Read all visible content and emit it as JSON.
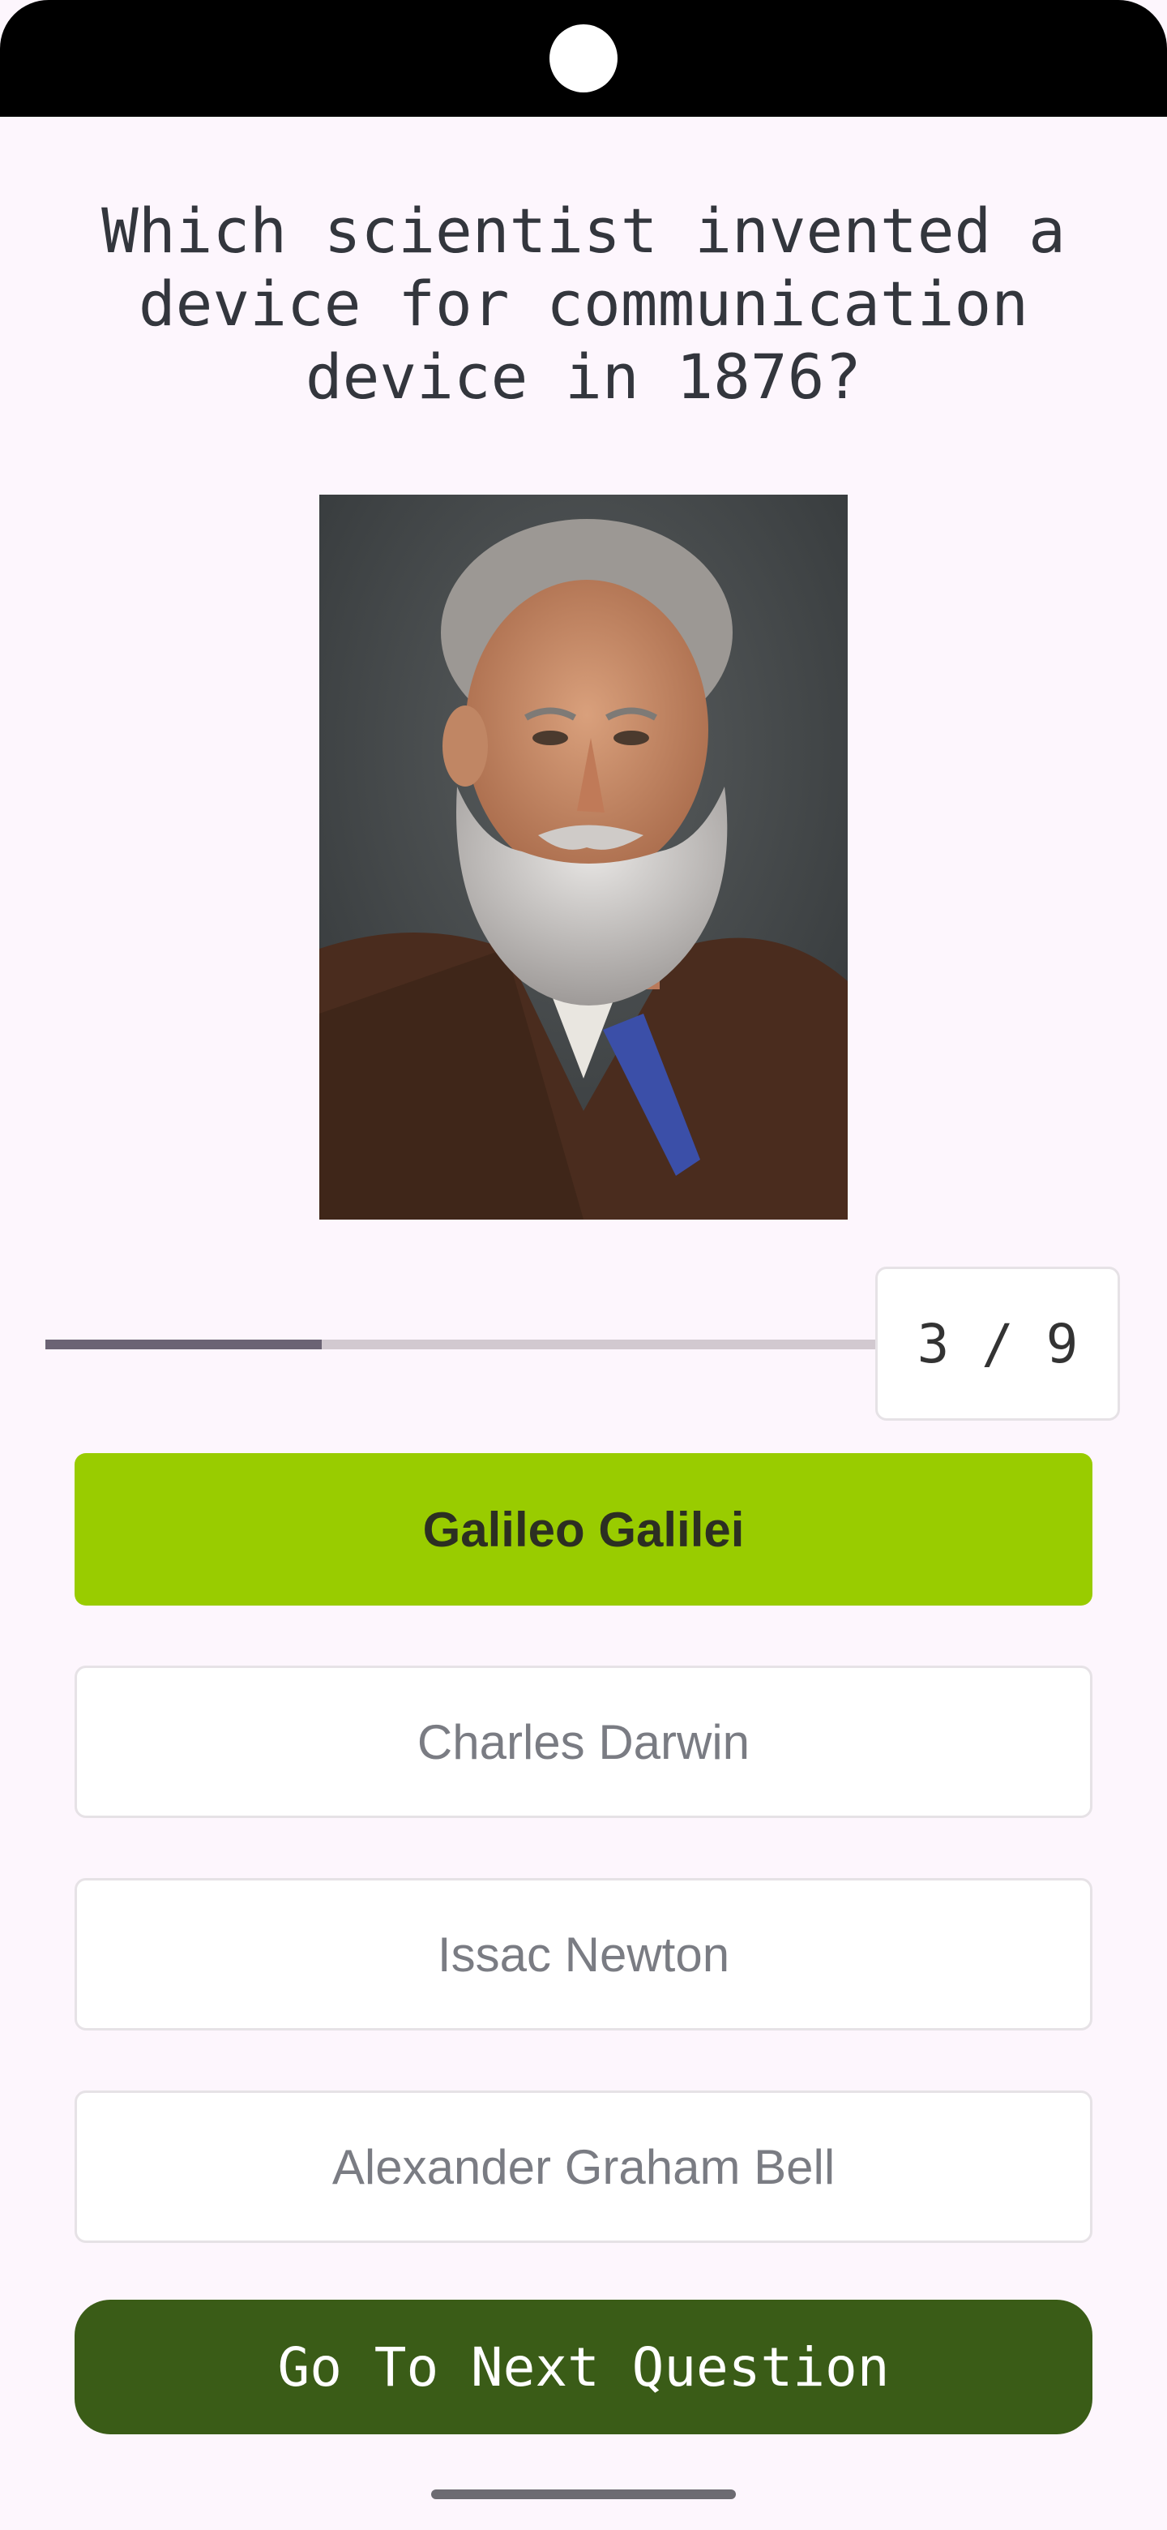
{
  "question": "Which scientist invented a device for communication device in 1876?",
  "progress": {
    "current": 3,
    "total": 9,
    "label": "3 / 9",
    "fraction": 0.333
  },
  "answers": [
    {
      "label": "Galileo Galilei",
      "selected": true
    },
    {
      "label": "Charles Darwin",
      "selected": false
    },
    {
      "label": "Issac Newton",
      "selected": false
    },
    {
      "label": "Alexander Graham Bell",
      "selected": false
    }
  ],
  "next_button": {
    "label": "Go To Next Question"
  },
  "colors": {
    "background": "#fdf6fd",
    "selected_answer": "#99cc00",
    "next_button": "#3a5c17",
    "progress_fill": "#6b6374",
    "progress_track": "#d2c9d0"
  }
}
